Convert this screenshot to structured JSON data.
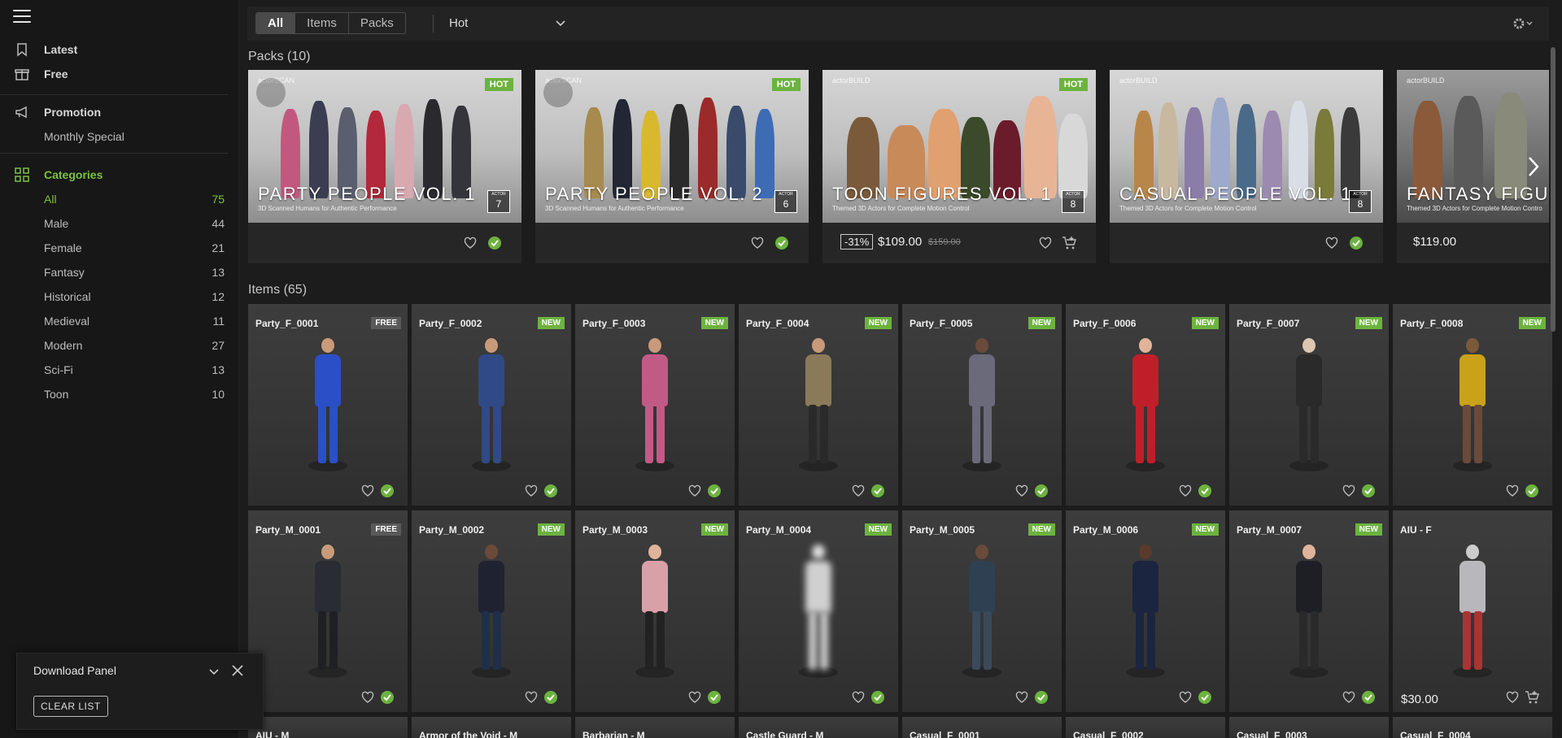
{
  "sidebar": {
    "latest": "Latest",
    "free": "Free",
    "promotion": "Promotion",
    "monthly_special": "Monthly Special",
    "categories_label": "Categories",
    "categories": [
      {
        "label": "All",
        "count": "75"
      },
      {
        "label": "Male",
        "count": "44"
      },
      {
        "label": "Female",
        "count": "21"
      },
      {
        "label": "Fantasy",
        "count": "13"
      },
      {
        "label": "Historical",
        "count": "12"
      },
      {
        "label": "Medieval",
        "count": "11"
      },
      {
        "label": "Modern",
        "count": "27"
      },
      {
        "label": "Sci-Fi",
        "count": "13"
      },
      {
        "label": "Toon",
        "count": "10"
      }
    ]
  },
  "download_panel": {
    "title": "Download Panel",
    "clear_label": "CLEAR LIST"
  },
  "toolbar": {
    "filters": [
      "All",
      "Items",
      "Packs"
    ],
    "sort_value": "Hot"
  },
  "packs_section": {
    "title": "Packs (10)"
  },
  "packs": [
    {
      "brand": "actorSCAN",
      "title": "PARTY PEOPLE VOL. 1",
      "subtitle": "3D Scanned Humans for Authentic Performance",
      "actor": "7",
      "badge": "HOT",
      "discount": "",
      "price": "",
      "old_price": ""
    },
    {
      "brand": "actorSCAN",
      "title": "PARTY PEOPLE VOL. 2",
      "subtitle": "3D Scanned Humans for Authentic Performance",
      "actor": "6",
      "badge": "HOT",
      "discount": "",
      "price": "",
      "old_price": ""
    },
    {
      "brand": "actorBUILD",
      "title": "TOON FIGURES VOL. 1",
      "subtitle": "Themed 3D Actors for Complete Motion Control",
      "actor": "8",
      "badge": "HOT",
      "discount": "-31%",
      "price": "$109.00",
      "old_price": "$159.00"
    },
    {
      "brand": "actorBUILD",
      "title": "CASUAL PEOPLE VOL. 1",
      "subtitle": "Themed 3D Actors for Complete Motion Control",
      "actor": "8",
      "badge": "",
      "discount": "",
      "price": "",
      "old_price": ""
    },
    {
      "brand": "actorBUILD",
      "title": "FANTASY FIGURES VO",
      "subtitle": "Themed 3D Actors for Complete Motion Contro",
      "actor": "",
      "badge": "",
      "discount": "",
      "price": "$119.00",
      "old_price": ""
    }
  ],
  "items_section": {
    "title": "Items (65)"
  },
  "items_row1": [
    {
      "name": "Party_F_0001",
      "badge": "FREE"
    },
    {
      "name": "Party_F_0002",
      "badge": "NEW"
    },
    {
      "name": "Party_F_0003",
      "badge": "NEW"
    },
    {
      "name": "Party_F_0004",
      "badge": "NEW"
    },
    {
      "name": "Party_F_0005",
      "badge": "NEW"
    },
    {
      "name": "Party_F_0006",
      "badge": "NEW"
    },
    {
      "name": "Party_F_0007",
      "badge": "NEW"
    },
    {
      "name": "Party_F_0008",
      "badge": "NEW"
    }
  ],
  "items_row2": [
    {
      "name": "Party_M_0001",
      "badge": "FREE"
    },
    {
      "name": "Party_M_0002",
      "badge": "NEW"
    },
    {
      "name": "Party_M_0003",
      "badge": "NEW"
    },
    {
      "name": "Party_M_0004",
      "badge": "NEW"
    },
    {
      "name": "Party_M_0005",
      "badge": "NEW"
    },
    {
      "name": "Party_M_0006",
      "badge": "NEW"
    },
    {
      "name": "Party_M_0007",
      "badge": "NEW"
    },
    {
      "name": "AIU - F",
      "badge": "",
      "price": "$30.00"
    }
  ],
  "items_row3": [
    {
      "name": "AIU - M"
    },
    {
      "name": "Armor of the Void - M"
    },
    {
      "name": "Barbarian - M"
    },
    {
      "name": "Castle Guard - M"
    },
    {
      "name": "Casual_F_0001"
    },
    {
      "name": "Casual_F_0002"
    },
    {
      "name": "Casual_F_0003"
    },
    {
      "name": "Casual_F_0004"
    }
  ],
  "colors": {
    "accent": "#7cc242",
    "badge_new": "#6cb33f",
    "badge_free": "#5a5a5a"
  }
}
